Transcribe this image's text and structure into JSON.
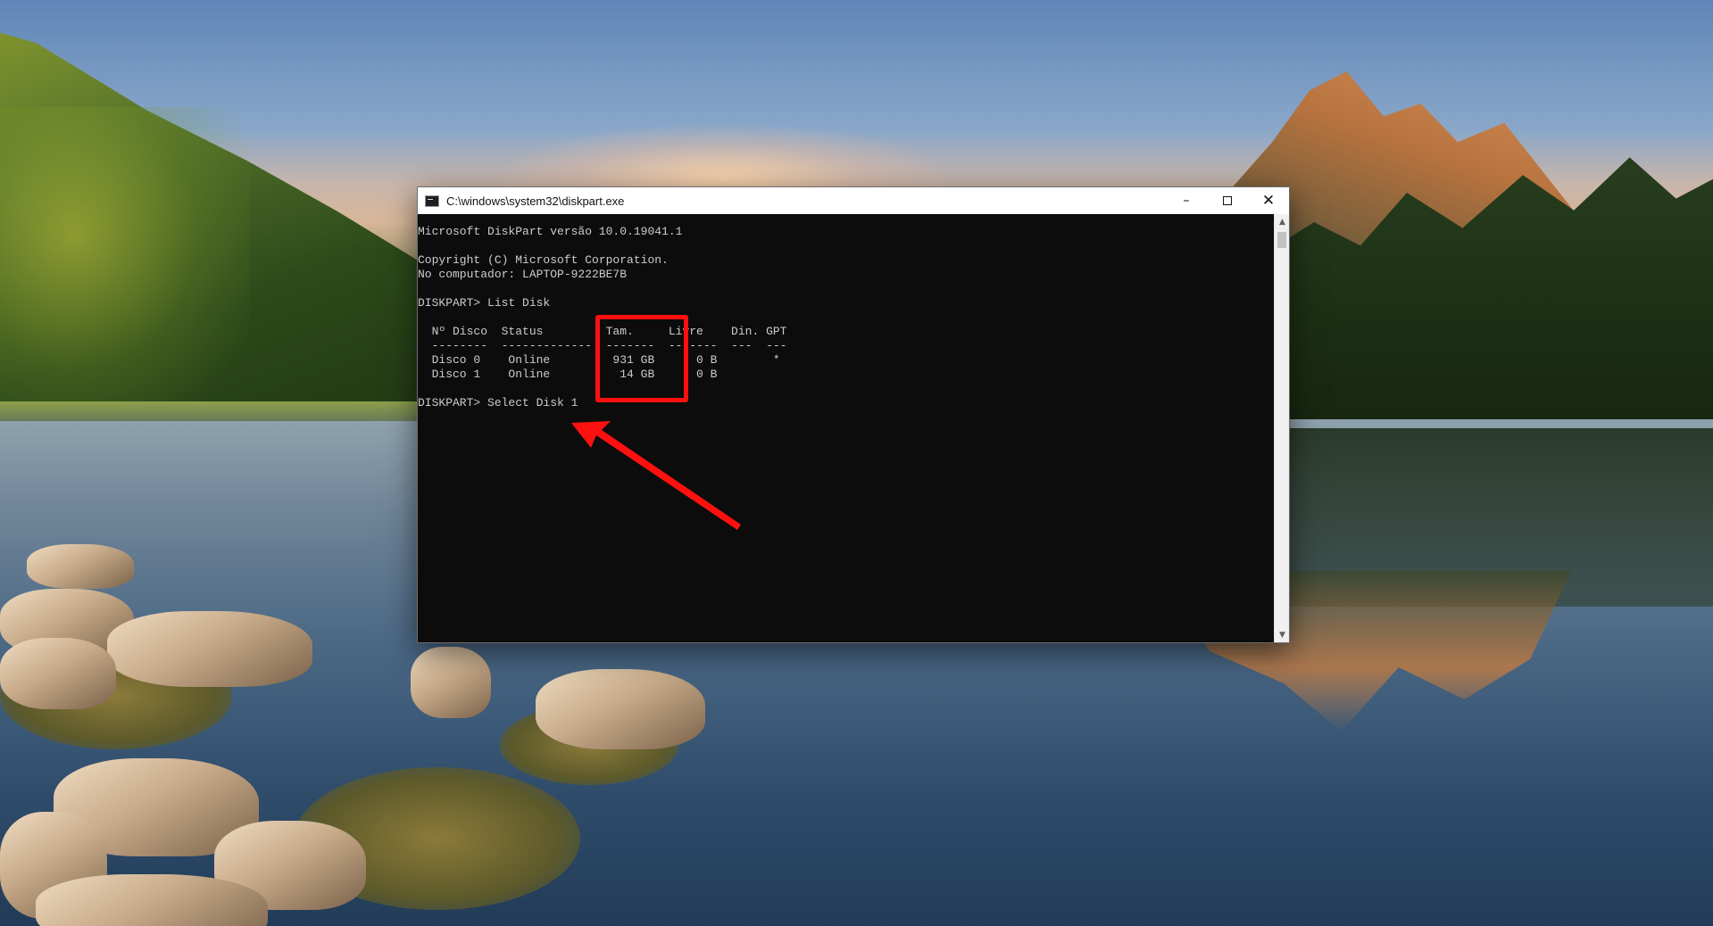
{
  "window": {
    "title": "C:\\windows\\system32\\diskpart.exe",
    "controls": {
      "minimize_icon": "minimize-icon",
      "maximize_icon": "maximize-icon",
      "close_icon": "close-icon"
    }
  },
  "console": {
    "lines": [
      "Microsoft DiskPart versão 10.0.19041.1",
      "",
      "Copyright (C) Microsoft Corporation.",
      "No computador: LAPTOP-9222BE7B",
      "",
      "DISKPART> List Disk",
      "",
      "  Nº Disco  Status         Tam.     Livre    Din. GPT",
      "  --------  -------------  -------  -------  ---  ---",
      "  Disco 0    Online         931 GB      0 B        *",
      "  Disco 1    Online          14 GB      0 B",
      "",
      "DISKPART> Select Disk 1"
    ]
  },
  "annotations": {
    "highlight_color": "#ff1010",
    "arrow_color": "#ff1010"
  },
  "colors": {
    "console_background": "#0c0c0c",
    "console_text": "#cccccc"
  }
}
